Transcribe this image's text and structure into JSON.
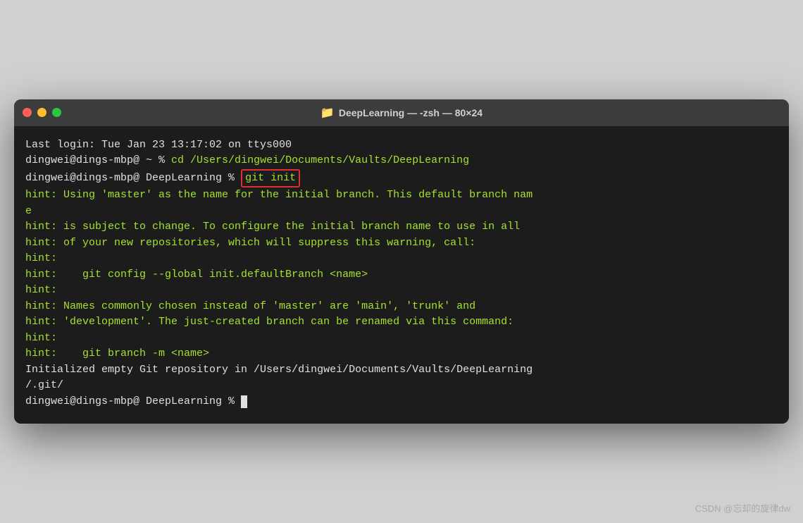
{
  "window": {
    "title": "DeepLearning — -zsh — 80×24",
    "folder_icon": "📁"
  },
  "traffic_lights": {
    "close": "close",
    "minimize": "minimize",
    "maximize": "maximize"
  },
  "terminal": {
    "line1": "Last login: Tue Jan 23 13:17:02 on ttys000",
    "line2_prompt": "dingwei@dings-mbp@ ~ % ",
    "line2_cmd": "cd /Users/dingwei/Documents/Vaults/DeepLearning",
    "line3_prompt": "dingwei@dings-mbp@ DeepLearning % ",
    "line3_cmd": "git init",
    "hint1": "hint: Using 'master' as the name for the initial branch. This default branch nam",
    "hint2": "e",
    "hint3": "hint: is subject to change. To configure the initial branch name to use in all",
    "hint4": "hint: of your new repositories, which will suppress this warning, call:",
    "hint5": "hint:",
    "hint6": "hint:    git config --global init.defaultBranch <name>",
    "hint7": "hint:",
    "hint8": "hint: Names commonly chosen instead of 'master' are 'main', 'trunk' and",
    "hint9": "hint: 'development'. The just-created branch can be renamed via this command:",
    "hint10": "hint:",
    "hint11": "hint:    git branch -m <name>",
    "init_line1": "Initialized empty Git repository in /Users/dingwei/Documents/Vaults/DeepLearning",
    "init_line2": "/.git/",
    "final_prompt": "dingwei@dings-mbp@ DeepLearning % "
  },
  "watermark": "CSDN @忘却的旋律dw"
}
